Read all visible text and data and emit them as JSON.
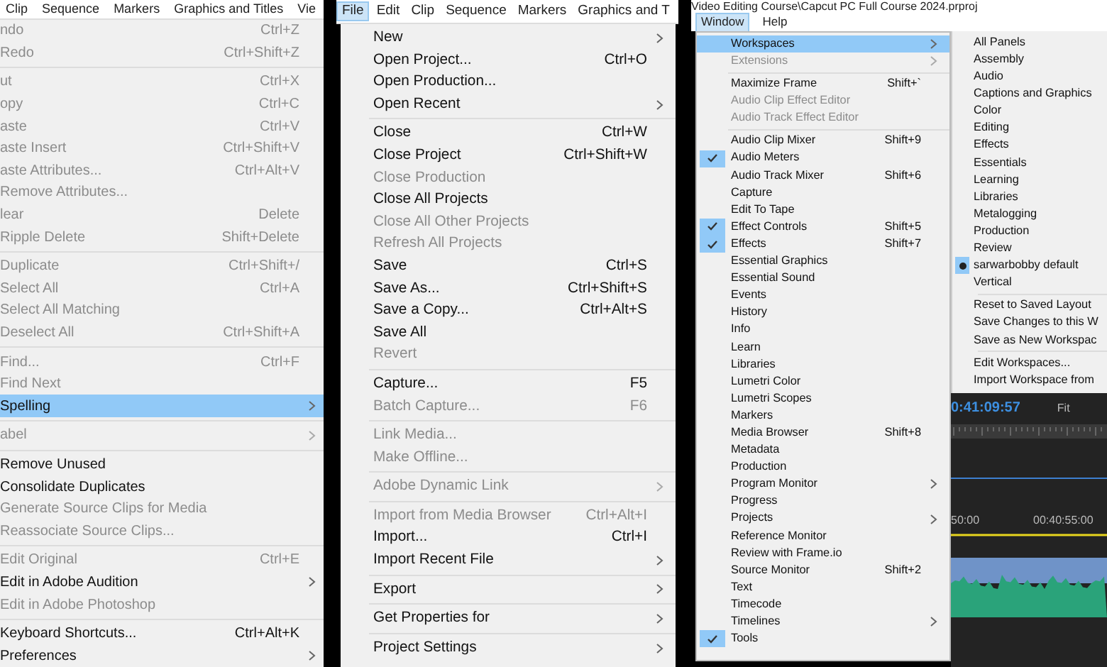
{
  "left_menu": {
    "menubar": [
      {
        "label": "Clip",
        "selected": false
      },
      {
        "label": "Sequence",
        "selected": false
      },
      {
        "label": "Markers",
        "selected": false
      },
      {
        "label": "Graphics and Titles",
        "selected": false
      },
      {
        "label": "Vie",
        "selected": false
      }
    ],
    "items": [
      {
        "kind": "item",
        "label": "ndo",
        "shortcut": "Ctrl+Z",
        "disabled": true,
        "highlighted": false,
        "submenu": false
      },
      {
        "kind": "item",
        "label": "Redo",
        "shortcut": "Ctrl+Shift+Z",
        "disabled": true,
        "highlighted": false,
        "submenu": false
      },
      {
        "kind": "separator"
      },
      {
        "kind": "item",
        "label": "ut",
        "shortcut": "Ctrl+X",
        "disabled": true,
        "highlighted": false,
        "submenu": false
      },
      {
        "kind": "item",
        "label": "opy",
        "shortcut": "Ctrl+C",
        "disabled": true,
        "highlighted": false,
        "submenu": false
      },
      {
        "kind": "item",
        "label": "aste",
        "shortcut": "Ctrl+V",
        "disabled": true,
        "highlighted": false,
        "submenu": false
      },
      {
        "kind": "item",
        "label": "aste Insert",
        "shortcut": "Ctrl+Shift+V",
        "disabled": true,
        "highlighted": false,
        "submenu": false
      },
      {
        "kind": "item",
        "label": "aste Attributes...",
        "shortcut": "Ctrl+Alt+V",
        "disabled": true,
        "highlighted": false,
        "submenu": false
      },
      {
        "kind": "item",
        "label": "Remove Attributes...",
        "disabled": true,
        "highlighted": false,
        "submenu": false
      },
      {
        "kind": "item",
        "label": "lear",
        "shortcut": "Delete",
        "disabled": true,
        "highlighted": false,
        "submenu": false
      },
      {
        "kind": "item",
        "label": "Ripple Delete",
        "shortcut": "Shift+Delete",
        "disabled": true,
        "highlighted": false,
        "submenu": false
      },
      {
        "kind": "separator"
      },
      {
        "kind": "item",
        "label": "Duplicate",
        "shortcut": "Ctrl+Shift+/",
        "disabled": true,
        "highlighted": false,
        "submenu": false
      },
      {
        "kind": "item",
        "label": "Select All",
        "shortcut": "Ctrl+A",
        "disabled": true,
        "highlighted": false,
        "submenu": false
      },
      {
        "kind": "item",
        "label": "Select All Matching",
        "disabled": true,
        "highlighted": false,
        "submenu": false
      },
      {
        "kind": "item",
        "label": "Deselect All",
        "shortcut": "Ctrl+Shift+A",
        "disabled": true,
        "highlighted": false,
        "submenu": false
      },
      {
        "kind": "separator"
      },
      {
        "kind": "item",
        "label": "Find...",
        "shortcut": "Ctrl+F",
        "disabled": true,
        "highlighted": false,
        "submenu": false
      },
      {
        "kind": "item",
        "label": "Find Next",
        "disabled": true,
        "highlighted": false,
        "submenu": false
      },
      {
        "kind": "item",
        "label": "Spelling",
        "disabled": false,
        "highlighted": true,
        "submenu": true
      },
      {
        "kind": "separator"
      },
      {
        "kind": "item",
        "label": "abel",
        "disabled": true,
        "highlighted": false,
        "submenu": true
      },
      {
        "kind": "separator"
      },
      {
        "kind": "item",
        "label": "Remove Unused",
        "disabled": false,
        "highlighted": false,
        "submenu": false
      },
      {
        "kind": "item",
        "label": "Consolidate Duplicates",
        "disabled": false,
        "highlighted": false,
        "submenu": false
      },
      {
        "kind": "item",
        "label": "Generate Source Clips for Media",
        "disabled": true,
        "highlighted": false,
        "submenu": false
      },
      {
        "kind": "item",
        "label": "Reassociate Source Clips...",
        "disabled": true,
        "highlighted": false,
        "submenu": false
      },
      {
        "kind": "separator"
      },
      {
        "kind": "item",
        "label": "Edit Original",
        "shortcut": "Ctrl+E",
        "disabled": true,
        "highlighted": false,
        "submenu": false
      },
      {
        "kind": "item",
        "label": "Edit in Adobe Audition",
        "disabled": false,
        "highlighted": false,
        "submenu": true
      },
      {
        "kind": "item",
        "label": "Edit in Adobe Photoshop",
        "disabled": true,
        "highlighted": false,
        "submenu": false
      },
      {
        "kind": "separator"
      },
      {
        "kind": "item",
        "label": "Keyboard Shortcuts...",
        "shortcut": "Ctrl+Alt+K",
        "disabled": false,
        "highlighted": false,
        "submenu": false
      },
      {
        "kind": "item",
        "label": "Preferences",
        "disabled": false,
        "highlighted": false,
        "submenu": true
      }
    ]
  },
  "file_menu": {
    "menubar": [
      {
        "label": "File",
        "selected": true
      },
      {
        "label": "Edit",
        "selected": false
      },
      {
        "label": "Clip",
        "selected": false
      },
      {
        "label": "Sequence",
        "selected": false
      },
      {
        "label": "Markers",
        "selected": false
      },
      {
        "label": "Graphics and T",
        "selected": false
      }
    ],
    "items": [
      {
        "kind": "item",
        "label": "New",
        "disabled": false,
        "highlighted": false,
        "submenu": true
      },
      {
        "kind": "item",
        "label": "Open Project...",
        "shortcut": "Ctrl+O",
        "disabled": false,
        "highlighted": false,
        "submenu": false
      },
      {
        "kind": "item",
        "label": "Open Production...",
        "disabled": false,
        "highlighted": false,
        "submenu": false
      },
      {
        "kind": "item",
        "label": "Open Recent",
        "disabled": false,
        "highlighted": false,
        "submenu": true
      },
      {
        "kind": "separator"
      },
      {
        "kind": "item",
        "label": "Close",
        "shortcut": "Ctrl+W",
        "disabled": false,
        "highlighted": false,
        "submenu": false
      },
      {
        "kind": "item",
        "label": "Close Project",
        "shortcut": "Ctrl+Shift+W",
        "disabled": false,
        "highlighted": false,
        "submenu": false
      },
      {
        "kind": "item",
        "label": "Close Production",
        "disabled": true,
        "highlighted": false,
        "submenu": false
      },
      {
        "kind": "item",
        "label": "Close All Projects",
        "disabled": false,
        "highlighted": false,
        "submenu": false
      },
      {
        "kind": "item",
        "label": "Close All Other Projects",
        "disabled": true,
        "highlighted": false,
        "submenu": false
      },
      {
        "kind": "item",
        "label": "Refresh All Projects",
        "disabled": true,
        "highlighted": false,
        "submenu": false
      },
      {
        "kind": "item",
        "label": "Save",
        "shortcut": "Ctrl+S",
        "disabled": false,
        "highlighted": false,
        "submenu": false
      },
      {
        "kind": "item",
        "label": "Save As...",
        "shortcut": "Ctrl+Shift+S",
        "disabled": false,
        "highlighted": false,
        "submenu": false
      },
      {
        "kind": "item",
        "label": "Save a Copy...",
        "shortcut": "Ctrl+Alt+S",
        "disabled": false,
        "highlighted": false,
        "submenu": false
      },
      {
        "kind": "item",
        "label": "Save All",
        "disabled": false,
        "highlighted": false,
        "submenu": false
      },
      {
        "kind": "item",
        "label": "Revert",
        "disabled": true,
        "highlighted": false,
        "submenu": false
      },
      {
        "kind": "separator"
      },
      {
        "kind": "item",
        "label": "Capture...",
        "shortcut": "F5",
        "disabled": false,
        "highlighted": false,
        "submenu": false
      },
      {
        "kind": "item",
        "label": "Batch Capture...",
        "shortcut": "F6",
        "disabled": true,
        "highlighted": false,
        "submenu": false
      },
      {
        "kind": "separator"
      },
      {
        "kind": "item",
        "label": "Link Media...",
        "disabled": true,
        "highlighted": false,
        "submenu": false
      },
      {
        "kind": "item",
        "label": "Make Offline...",
        "disabled": true,
        "highlighted": false,
        "submenu": false
      },
      {
        "kind": "separator"
      },
      {
        "kind": "item",
        "label": "Adobe Dynamic Link",
        "disabled": true,
        "highlighted": false,
        "submenu": true
      },
      {
        "kind": "separator"
      },
      {
        "kind": "item",
        "label": "Import from Media Browser",
        "shortcut": "Ctrl+Alt+I",
        "disabled": true,
        "highlighted": false,
        "submenu": false
      },
      {
        "kind": "item",
        "label": "Import...",
        "shortcut": "Ctrl+I",
        "disabled": false,
        "highlighted": false,
        "submenu": false
      },
      {
        "kind": "item",
        "label": "Import Recent File",
        "disabled": false,
        "highlighted": false,
        "submenu": true
      },
      {
        "kind": "separator"
      },
      {
        "kind": "item",
        "label": "Export",
        "disabled": false,
        "highlighted": false,
        "submenu": true
      },
      {
        "kind": "separator"
      },
      {
        "kind": "item",
        "label": "Get Properties for",
        "disabled": false,
        "highlighted": false,
        "submenu": true
      },
      {
        "kind": "separator"
      },
      {
        "kind": "item",
        "label": "Project Settings",
        "disabled": false,
        "highlighted": false,
        "submenu": true
      }
    ]
  },
  "window_menu": {
    "title": "Video Editing Course\\Capcut PC Full Course 2024.prproj",
    "menubar": [
      {
        "label": "Window",
        "selected": true
      },
      {
        "label": "Help",
        "selected": false
      }
    ],
    "items": [
      {
        "kind": "item",
        "label": "Workspaces",
        "disabled": false,
        "highlighted": true,
        "submenu": true,
        "checked": false
      },
      {
        "kind": "item",
        "label": "Extensions",
        "disabled": true,
        "highlighted": false,
        "submenu": true,
        "checked": false
      },
      {
        "kind": "separator"
      },
      {
        "kind": "item",
        "label": "Maximize Frame",
        "shortcut": "Shift+`",
        "disabled": false,
        "highlighted": false,
        "submenu": false,
        "checked": false
      },
      {
        "kind": "item",
        "label": "Audio Clip Effect Editor",
        "disabled": true,
        "highlighted": false,
        "submenu": false,
        "checked": false
      },
      {
        "kind": "item",
        "label": "Audio Track Effect Editor",
        "disabled": true,
        "highlighted": false,
        "submenu": false,
        "checked": false
      },
      {
        "kind": "separator"
      },
      {
        "kind": "item",
        "label": "Audio Clip Mixer",
        "shortcut": "Shift+9",
        "disabled": false,
        "highlighted": false,
        "submenu": false,
        "checked": false
      },
      {
        "kind": "item",
        "label": "Audio Meters",
        "disabled": false,
        "highlighted": false,
        "submenu": false,
        "checked": true
      },
      {
        "kind": "item",
        "label": "Audio Track Mixer",
        "shortcut": "Shift+6",
        "disabled": false,
        "highlighted": false,
        "submenu": false,
        "checked": false
      },
      {
        "kind": "item",
        "label": "Capture",
        "disabled": false,
        "highlighted": false,
        "submenu": false,
        "checked": false
      },
      {
        "kind": "item",
        "label": "Edit To Tape",
        "disabled": false,
        "highlighted": false,
        "submenu": false,
        "checked": false
      },
      {
        "kind": "item",
        "label": "Effect Controls",
        "shortcut": "Shift+5",
        "disabled": false,
        "highlighted": false,
        "submenu": false,
        "checked": true
      },
      {
        "kind": "item",
        "label": "Effects",
        "shortcut": "Shift+7",
        "disabled": false,
        "highlighted": false,
        "submenu": false,
        "checked": true
      },
      {
        "kind": "item",
        "label": "Essential Graphics",
        "disabled": false,
        "highlighted": false,
        "submenu": false,
        "checked": false
      },
      {
        "kind": "item",
        "label": "Essential Sound",
        "disabled": false,
        "highlighted": false,
        "submenu": false,
        "checked": false
      },
      {
        "kind": "item",
        "label": "Events",
        "disabled": false,
        "highlighted": false,
        "submenu": false,
        "checked": false
      },
      {
        "kind": "item",
        "label": "History",
        "disabled": false,
        "highlighted": false,
        "submenu": false,
        "checked": false
      },
      {
        "kind": "item",
        "label": "Info",
        "disabled": false,
        "highlighted": false,
        "submenu": false,
        "checked": false
      },
      {
        "kind": "item",
        "label": "Learn",
        "disabled": false,
        "highlighted": false,
        "submenu": false,
        "checked": false
      },
      {
        "kind": "item",
        "label": "Libraries",
        "disabled": false,
        "highlighted": false,
        "submenu": false,
        "checked": false
      },
      {
        "kind": "item",
        "label": "Lumetri Color",
        "disabled": false,
        "highlighted": false,
        "submenu": false,
        "checked": false
      },
      {
        "kind": "item",
        "label": "Lumetri Scopes",
        "disabled": false,
        "highlighted": false,
        "submenu": false,
        "checked": false
      },
      {
        "kind": "item",
        "label": "Markers",
        "disabled": false,
        "highlighted": false,
        "submenu": false,
        "checked": false
      },
      {
        "kind": "item",
        "label": "Media Browser",
        "shortcut": "Shift+8",
        "disabled": false,
        "highlighted": false,
        "submenu": false,
        "checked": false
      },
      {
        "kind": "item",
        "label": "Metadata",
        "disabled": false,
        "highlighted": false,
        "submenu": false,
        "checked": false
      },
      {
        "kind": "item",
        "label": "Production",
        "disabled": false,
        "highlighted": false,
        "submenu": false,
        "checked": false
      },
      {
        "kind": "item",
        "label": "Program Monitor",
        "disabled": false,
        "highlighted": false,
        "submenu": true,
        "checked": false
      },
      {
        "kind": "item",
        "label": "Progress",
        "disabled": false,
        "highlighted": false,
        "submenu": false,
        "checked": false
      },
      {
        "kind": "item",
        "label": "Projects",
        "disabled": false,
        "highlighted": false,
        "submenu": true,
        "checked": false
      },
      {
        "kind": "item",
        "label": "Reference Monitor",
        "disabled": false,
        "highlighted": false,
        "submenu": false,
        "checked": false
      },
      {
        "kind": "item",
        "label": "Review with Frame.io",
        "disabled": false,
        "highlighted": false,
        "submenu": false,
        "checked": false
      },
      {
        "kind": "item",
        "label": "Source Monitor",
        "shortcut": "Shift+2",
        "disabled": false,
        "highlighted": false,
        "submenu": false,
        "checked": false
      },
      {
        "kind": "item",
        "label": "Text",
        "disabled": false,
        "highlighted": false,
        "submenu": false,
        "checked": false
      },
      {
        "kind": "item",
        "label": "Timecode",
        "disabled": false,
        "highlighted": false,
        "submenu": false,
        "checked": false
      },
      {
        "kind": "item",
        "label": "Timelines",
        "disabled": false,
        "highlighted": false,
        "submenu": true,
        "checked": false
      },
      {
        "kind": "item",
        "label": "Tools",
        "disabled": false,
        "highlighted": false,
        "submenu": false,
        "checked": true
      }
    ],
    "workspaces_submenu": {
      "items": [
        {
          "kind": "item",
          "label": "All Panels",
          "selected": false
        },
        {
          "kind": "item",
          "label": "Assembly",
          "selected": false
        },
        {
          "kind": "item",
          "label": "Audio",
          "selected": false
        },
        {
          "kind": "item",
          "label": "Captions and Graphics",
          "selected": false
        },
        {
          "kind": "item",
          "label": "Color",
          "selected": false
        },
        {
          "kind": "item",
          "label": "Editing",
          "selected": false
        },
        {
          "kind": "item",
          "label": "Effects",
          "selected": false
        },
        {
          "kind": "item",
          "label": "Essentials",
          "selected": false
        },
        {
          "kind": "item",
          "label": "Learning",
          "selected": false
        },
        {
          "kind": "item",
          "label": "Libraries",
          "selected": false
        },
        {
          "kind": "item",
          "label": "Metalogging",
          "selected": false
        },
        {
          "kind": "item",
          "label": "Production",
          "selected": false
        },
        {
          "kind": "item",
          "label": "Review",
          "selected": false
        },
        {
          "kind": "item",
          "label": "sarwarbobby default",
          "selected": true
        },
        {
          "kind": "item",
          "label": "Vertical",
          "selected": false
        },
        {
          "kind": "separator"
        },
        {
          "kind": "item",
          "label": "Reset to Saved Layout",
          "selected": false
        },
        {
          "kind": "item",
          "label": "Save Changes to this W",
          "selected": false
        },
        {
          "kind": "item",
          "label": "Save as New Workspac",
          "selected": false
        },
        {
          "kind": "separator"
        },
        {
          "kind": "item",
          "label": "Edit Workspaces...",
          "selected": false
        },
        {
          "kind": "item",
          "label": "Import Workspace from",
          "selected": false
        }
      ]
    },
    "timeline": {
      "timecode": "0:41:09:57",
      "zoom": "Fit",
      "ruler_labels": [
        "50:00",
        "00:40:55:00"
      ]
    }
  }
}
